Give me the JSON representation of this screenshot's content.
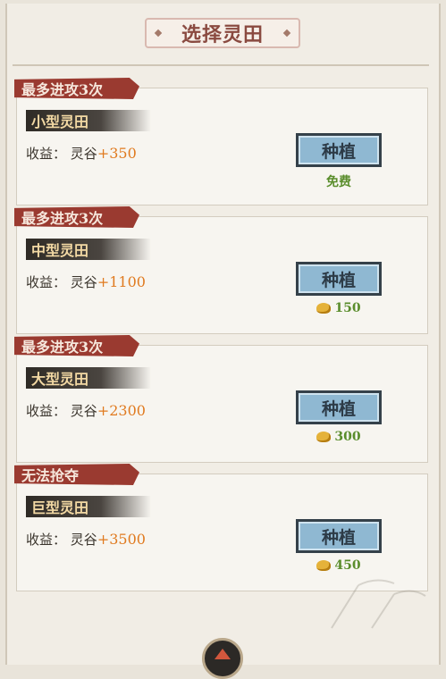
{
  "title": "选择灵田",
  "income_label": "收益：",
  "income_resource": "灵谷",
  "plant_label": "种植",
  "cards": [
    {
      "limit": "最多进攻3次",
      "name": "小型灵田",
      "income": "+350",
      "cost": "免费",
      "has_coin": false
    },
    {
      "limit": "最多进攻3次",
      "name": "中型灵田",
      "income": "+1100",
      "cost": "150",
      "has_coin": true
    },
    {
      "limit": "最多进攻3次",
      "name": "大型灵田",
      "income": "+2300",
      "cost": "300",
      "has_coin": true
    },
    {
      "limit": "无法抢夺",
      "name": "巨型灵田",
      "income": "+3500",
      "cost": "450",
      "has_coin": true
    }
  ],
  "colors": {
    "ribbon": "#9a3a30",
    "income_value": "#e07a1f",
    "cost": "#5a8d2c",
    "button": "#8fb8d2"
  },
  "icons": {
    "coin": "gold-ingot-icon",
    "badge": "bottom-emblem-icon"
  }
}
